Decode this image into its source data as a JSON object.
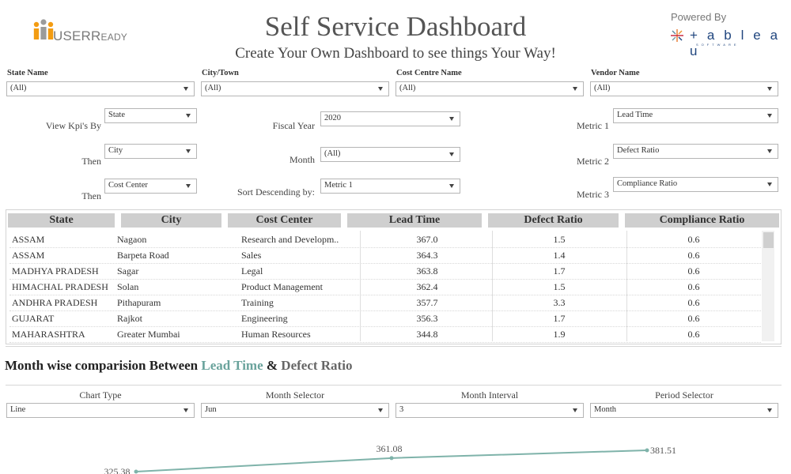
{
  "header": {
    "brand": "USER",
    "brand_small": "EADY",
    "brand_cap": "R",
    "title": "Self Service Dashboard",
    "subtitle": "Create Your Own Dashboard to see things Your Way!",
    "powered_by": "Powered By",
    "tableau_word": "+ a b l e a u",
    "tableau_sub": "SOFTWARE"
  },
  "filters": [
    {
      "label": "State Name",
      "value": "(All)"
    },
    {
      "label": "City/Town",
      "value": "(All)"
    },
    {
      "label": "Cost Centre Name",
      "value": "(All)"
    },
    {
      "label": "Vendor Name",
      "value": "(All)"
    }
  ],
  "params": {
    "view_kpis_by": {
      "label": "View Kpi's By",
      "value": "State"
    },
    "then1": {
      "label": "Then",
      "value": "City"
    },
    "then2": {
      "label": "Then",
      "value": "Cost Center"
    },
    "fiscal_year": {
      "label": "Fiscal Year",
      "value": "2020"
    },
    "month": {
      "label": "Month",
      "value": "(All)"
    },
    "sort_desc": {
      "label": "Sort Descending by:",
      "value": "Metric 1"
    },
    "metric1": {
      "label": "Metric 1",
      "value": "Lead Time"
    },
    "metric2": {
      "label": "Metric 2",
      "value": "Defect Ratio"
    },
    "metric3": {
      "label": "Metric 3",
      "value": "Compliance Ratio"
    }
  },
  "table": {
    "headers": [
      "State",
      "City",
      "Cost Center",
      "Lead Time",
      "Defect Ratio",
      "Compliance Ratio"
    ],
    "rows": [
      [
        "ASSAM",
        "Nagaon",
        "Research and Developm..",
        "367.0",
        "1.5",
        "0.6"
      ],
      [
        "ASSAM",
        "Barpeta Road",
        "Sales",
        "364.3",
        "1.4",
        "0.6"
      ],
      [
        "MADHYA PRADESH",
        "Sagar",
        "Legal",
        "363.8",
        "1.7",
        "0.6"
      ],
      [
        "HIMACHAL PRADESH",
        "Solan",
        "Product Management",
        "362.4",
        "1.5",
        "0.6"
      ],
      [
        "ANDHRA PRADESH",
        "Pithapuram",
        "Training",
        "357.7",
        "3.3",
        "0.6"
      ],
      [
        "GUJARAT",
        "Rajkot",
        "Engineering",
        "356.3",
        "1.7",
        "0.6"
      ],
      [
        "MAHARASHTRA",
        "Greater Mumbai",
        "Human Resources",
        "344.8",
        "1.9",
        "0.6"
      ]
    ]
  },
  "section": {
    "prefix": "Month wise comparision Between",
    "metric_a": "Lead Time",
    "amp": "&",
    "metric_b": "Defect Ratio"
  },
  "chart_controls": [
    {
      "label": "Chart Type",
      "value": "Line"
    },
    {
      "label": "Month Selector",
      "value": "Jun"
    },
    {
      "label": "Month Interval",
      "value": "3"
    },
    {
      "label": "Period Selector",
      "value": "Month"
    }
  ],
  "chart_data": {
    "type": "line",
    "series": [
      {
        "values": [
          325.38,
          361.08,
          381.51
        ]
      }
    ],
    "labels": [
      "325.38",
      "361.08",
      "381.51"
    ],
    "line_color": "#7fb3aa"
  },
  "colors": {
    "accent_teal": "#6aa39c",
    "header_gray": "#cfcfcf",
    "tableau_blue": "#1f457e"
  }
}
